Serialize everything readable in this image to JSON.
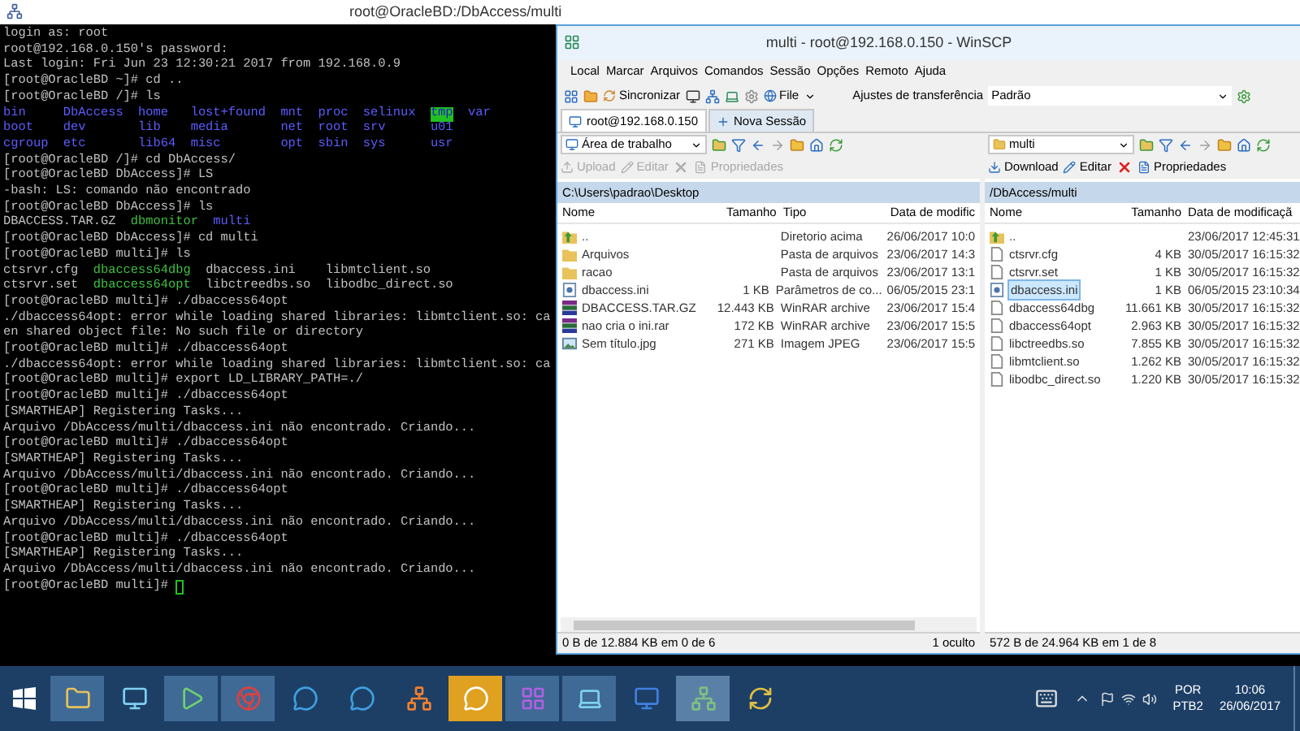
{
  "putty": {
    "title": "root@OracleBD:/DbAccess/multi",
    "lines": [
      {
        "kind": "text",
        "text": "login as: root"
      },
      {
        "kind": "text",
        "text": "root@192.168.0.150's password:"
      },
      {
        "kind": "text",
        "text": "Last login: Fri Jun 23 12:30:21 2017 from 192.168.0.9"
      },
      {
        "kind": "text",
        "text": "[root@OracleBD ~]# cd .."
      },
      {
        "kind": "text",
        "text": "[root@OracleBD /]# ls"
      },
      {
        "kind": "listing",
        "rows": [
          [
            {
              "text": "bin",
              "kind": "dir"
            },
            {
              "text": "DbAccess",
              "kind": "dir"
            },
            {
              "text": "home",
              "kind": "dir"
            },
            {
              "text": "lost+found",
              "kind": "dir"
            },
            {
              "text": "mnt",
              "kind": "dir"
            },
            {
              "text": "proc",
              "kind": "dir"
            },
            {
              "text": "selinux",
              "kind": "dir"
            },
            {
              "text": "tmp",
              "kind": "sticky"
            },
            {
              "text": "var",
              "kind": "dir"
            }
          ],
          [
            {
              "text": "boot",
              "kind": "dir"
            },
            {
              "text": "dev",
              "kind": "dir"
            },
            {
              "text": "lib",
              "kind": "dir"
            },
            {
              "text": "media",
              "kind": "dir"
            },
            {
              "text": "net",
              "kind": "dir"
            },
            {
              "text": "root",
              "kind": "dir"
            },
            {
              "text": "srv",
              "kind": "dir"
            },
            {
              "text": "u01",
              "kind": "dir"
            }
          ],
          [
            {
              "text": "cgroup",
              "kind": "dir"
            },
            {
              "text": "etc",
              "kind": "dir"
            },
            {
              "text": "lib64",
              "kind": "dir"
            },
            {
              "text": "misc",
              "kind": "dir"
            },
            {
              "text": "opt",
              "kind": "dir"
            },
            {
              "text": "sbin",
              "kind": "dir"
            },
            {
              "text": "sys",
              "kind": "dir"
            },
            {
              "text": "usr",
              "kind": "dir"
            }
          ]
        ]
      },
      {
        "kind": "text",
        "text": "[root@OracleBD /]# cd DbAccess/"
      },
      {
        "kind": "text",
        "text": "[root@OracleBD DbAccess]# LS"
      },
      {
        "kind": "text",
        "text": "-bash: LS: comando não encontrado"
      },
      {
        "kind": "text",
        "text": "[root@OracleBD DbAccess]# ls"
      },
      {
        "kind": "listing",
        "rows": [
          [
            {
              "text": "DBACCESS.TAR.GZ",
              "kind": "plain"
            },
            {
              "text": "dbmonitor",
              "kind": "exec"
            },
            {
              "text": "multi",
              "kind": "dir"
            }
          ]
        ]
      },
      {
        "kind": "text",
        "text": "[root@OracleBD DbAccess]# cd multi"
      },
      {
        "kind": "text",
        "text": "[root@OracleBD multi]# ls"
      },
      {
        "kind": "listing",
        "rows": [
          [
            {
              "text": "ctsrvr.cfg",
              "kind": "plain"
            },
            {
              "text": "dbaccess64dbg",
              "kind": "exec"
            },
            {
              "text": "dbaccess.ini",
              "kind": "plain"
            },
            {
              "text": "libmtclient.so",
              "kind": "plain"
            }
          ],
          [
            {
              "text": "ctsrvr.set",
              "kind": "plain"
            },
            {
              "text": "dbaccess64opt",
              "kind": "exec"
            },
            {
              "text": "libctreedbs.so",
              "kind": "plain"
            },
            {
              "text": "libodbc_direct.so",
              "kind": "plain"
            }
          ]
        ]
      },
      {
        "kind": "text",
        "text": "[root@OracleBD multi]# ./dbaccess64opt"
      },
      {
        "kind": "text",
        "text": "./dbaccess64opt: error while loading shared libraries: libmtclient.so: ca"
      },
      {
        "kind": "text",
        "text": "en shared object file: No such file or directory"
      },
      {
        "kind": "text",
        "text": "[root@OracleBD multi]# ./dbaccess64opt"
      },
      {
        "kind": "text",
        "text": "./dbaccess64opt: error while loading shared libraries: libmtclient.so: ca"
      },
      {
        "kind": "text",
        "text": "[root@OracleBD multi]# export LD_LIBRARY_PATH=./"
      },
      {
        "kind": "text",
        "text": "[root@OracleBD multi]# ./dbaccess64opt"
      },
      {
        "kind": "text",
        "text": "[SMARTHEAP] Registering Tasks..."
      },
      {
        "kind": "text",
        "text": "Arquivo /DbAccess/multi/dbaccess.ini não encontrado. Criando..."
      },
      {
        "kind": "text",
        "text": "[root@OracleBD multi]# ./dbaccess64opt"
      },
      {
        "kind": "text",
        "text": "[SMARTHEAP] Registering Tasks..."
      },
      {
        "kind": "text",
        "text": "Arquivo /DbAccess/multi/dbaccess.ini não encontrado. Criando..."
      },
      {
        "kind": "text",
        "text": "[root@OracleBD multi]# ./dbaccess64opt"
      },
      {
        "kind": "text",
        "text": "[SMARTHEAP] Registering Tasks..."
      },
      {
        "kind": "text",
        "text": "Arquivo /DbAccess/multi/dbaccess.ini não encontrado. Criando..."
      },
      {
        "kind": "text",
        "text": "[root@OracleBD multi]# ./dbaccess64opt"
      },
      {
        "kind": "text",
        "text": "[SMARTHEAP] Registering Tasks..."
      },
      {
        "kind": "text",
        "text": "Arquivo /DbAccess/multi/dbaccess.ini não encontrado. Criando..."
      },
      {
        "kind": "prompt",
        "text": "[root@OracleBD multi]#"
      }
    ]
  },
  "winscp": {
    "title": "multi - root@192.168.0.150 - WinSCP",
    "menu": [
      "Local",
      "Marcar",
      "Arquivos",
      "Comandos",
      "Sessão",
      "Opções",
      "Remoto",
      "Ajuda"
    ],
    "toolbar": {
      "sync": "Sincronizar",
      "file": "File",
      "transfer_label": "Ajustes de transferência",
      "transfer_value": "Padrão"
    },
    "session_tabs": [
      {
        "label": "root@192.168.0.150",
        "selected": true
      },
      {
        "label": "Nova Sessão",
        "selected": false
      }
    ],
    "panels": [
      {
        "location": "Área de trabalho",
        "path": "C:\\Users\\padrao\\Desktop",
        "actions": [
          {
            "kind": "upload",
            "label": "Upload",
            "disabled": true
          },
          {
            "kind": "edit",
            "label": "Editar",
            "disabled": true
          },
          {
            "kind": "delete",
            "disabled": true
          },
          {
            "kind": "properties",
            "label": "Propriedades",
            "disabled": true
          }
        ],
        "columns": [
          "Nome",
          "Tamanho",
          "Tipo",
          "Data de modific"
        ],
        "rows": [
          {
            "kind": "up",
            "selected": false,
            "name": "..",
            "type": "Diretorio acima",
            "date": "26/06/2017 10:0"
          },
          {
            "kind": "folder",
            "selected": false,
            "name": "Arquivos",
            "type": "Pasta de arquivos",
            "date": "23/06/2017 14:3"
          },
          {
            "kind": "folder",
            "selected": false,
            "name": "racao",
            "type": "Pasta de arquivos",
            "date": "23/06/2017 13:1"
          },
          {
            "kind": "ini",
            "selected": false,
            "name": "dbaccess.ini",
            "size": "1 KB",
            "type": "Parâmetros de co...",
            "date": "06/05/2015 23:1"
          },
          {
            "kind": "rar",
            "selected": false,
            "name": "DBACCESS.TAR.GZ",
            "size": "12.443 KB",
            "type": "WinRAR archive",
            "date": "23/06/2017 15:4"
          },
          {
            "kind": "rar",
            "selected": false,
            "name": "nao cria o ini.rar",
            "size": "172 KB",
            "type": "WinRAR archive",
            "date": "23/06/2017 15:5"
          },
          {
            "kind": "image",
            "selected": false,
            "name": "Sem título.jpg",
            "size": "271 KB",
            "type": "Imagem JPEG",
            "date": "23/06/2017 15:5"
          }
        ],
        "status": "0 B de 12.884 KB em 0 de 6",
        "status_extra": "1 oculto"
      },
      {
        "location": "multi",
        "path": "/DbAccess/multi",
        "actions": [
          {
            "kind": "download",
            "label": "Download",
            "disabled": false
          },
          {
            "kind": "edit",
            "label": "Editar",
            "disabled": false
          },
          {
            "kind": "delete",
            "disabled": false
          },
          {
            "kind": "properties",
            "label": "Propriedades",
            "disabled": false
          }
        ],
        "columns": [
          "Nome",
          "Tamanho",
          "Data de modificaçã"
        ],
        "rows": [
          {
            "kind": "up",
            "selected": false,
            "name": "..",
            "date": "23/06/2017 12:45:31"
          },
          {
            "kind": "file",
            "selected": false,
            "name": "ctsrvr.cfg",
            "size": "4 KB",
            "date": "30/05/2017 16:15:32"
          },
          {
            "kind": "file",
            "selected": false,
            "name": "ctsrvr.set",
            "size": "1 KB",
            "date": "30/05/2017 16:15:32"
          },
          {
            "kind": "ini",
            "selected": true,
            "name": "dbaccess.ini",
            "size": "1 KB",
            "date": "06/05/2015 23:10:34"
          },
          {
            "kind": "file",
            "selected": false,
            "name": "dbaccess64dbg",
            "size": "11.661 KB",
            "date": "30/05/2017 16:15:32"
          },
          {
            "kind": "file",
            "selected": false,
            "name": "dbaccess64opt",
            "size": "2.963 KB",
            "date": "30/05/2017 16:15:32"
          },
          {
            "kind": "file",
            "selected": false,
            "name": "libctreedbs.so",
            "size": "7.855 KB",
            "date": "30/05/2017 16:15:32"
          },
          {
            "kind": "file",
            "selected": false,
            "name": "libmtclient.so",
            "size": "1.262 KB",
            "date": "30/05/2017 16:15:32"
          },
          {
            "kind": "file",
            "selected": false,
            "name": "libodbc_direct.so",
            "size": "1.220 KB",
            "date": "30/05/2017 16:15:32"
          }
        ],
        "status": "572 B de 24.964 KB em 1 de 8"
      }
    ]
  },
  "taskbar": {
    "language": "POR",
    "layout": "PTB2",
    "time": "10:06",
    "date": "26/06/2017"
  }
}
